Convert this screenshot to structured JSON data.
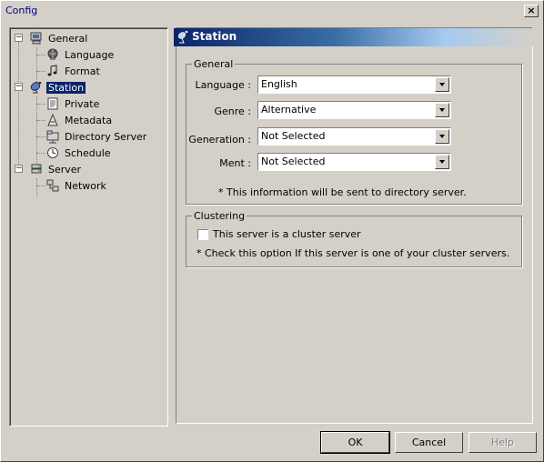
{
  "window": {
    "title": "Config",
    "close_glyph": "×"
  },
  "tree": {
    "items": [
      {
        "label": "General",
        "icon": "computer-icon",
        "level": 0,
        "expander": "−"
      },
      {
        "label": "Language",
        "icon": "globe-icon",
        "level": 1
      },
      {
        "label": "Format",
        "icon": "music-note-icon",
        "level": 1
      },
      {
        "label": "Station",
        "icon": "satellite-dish-icon",
        "level": 0,
        "expander": "−",
        "selected": true
      },
      {
        "label": "Private",
        "icon": "document-icon",
        "level": 1
      },
      {
        "label": "Metadata",
        "icon": "metadata-icon",
        "level": 1
      },
      {
        "label": "Directory Server",
        "icon": "network-folder-icon",
        "level": 1
      },
      {
        "label": "Schedule",
        "icon": "clock-icon",
        "level": 1
      },
      {
        "label": "Server",
        "icon": "server-icon",
        "level": 0,
        "expander": "−"
      },
      {
        "label": "Network",
        "icon": "network-icon",
        "level": 1
      }
    ]
  },
  "panel": {
    "header": "Station",
    "general": {
      "legend": "General",
      "fields": [
        {
          "label": "Language :",
          "value": "English"
        },
        {
          "label": "Genre :",
          "value": "Alternative"
        },
        {
          "label": "Generation :",
          "value": "Not Selected"
        },
        {
          "label": "Ment :",
          "value": "Not Selected"
        }
      ],
      "note": "* This information will be sent to directory server."
    },
    "clustering": {
      "legend": "Clustering",
      "checkbox_label": "This server is a cluster server",
      "checked": false,
      "note": "* Check this option If this server is one of your cluster servers."
    }
  },
  "buttons": {
    "ok": "OK",
    "cancel": "Cancel",
    "help": "Help"
  }
}
